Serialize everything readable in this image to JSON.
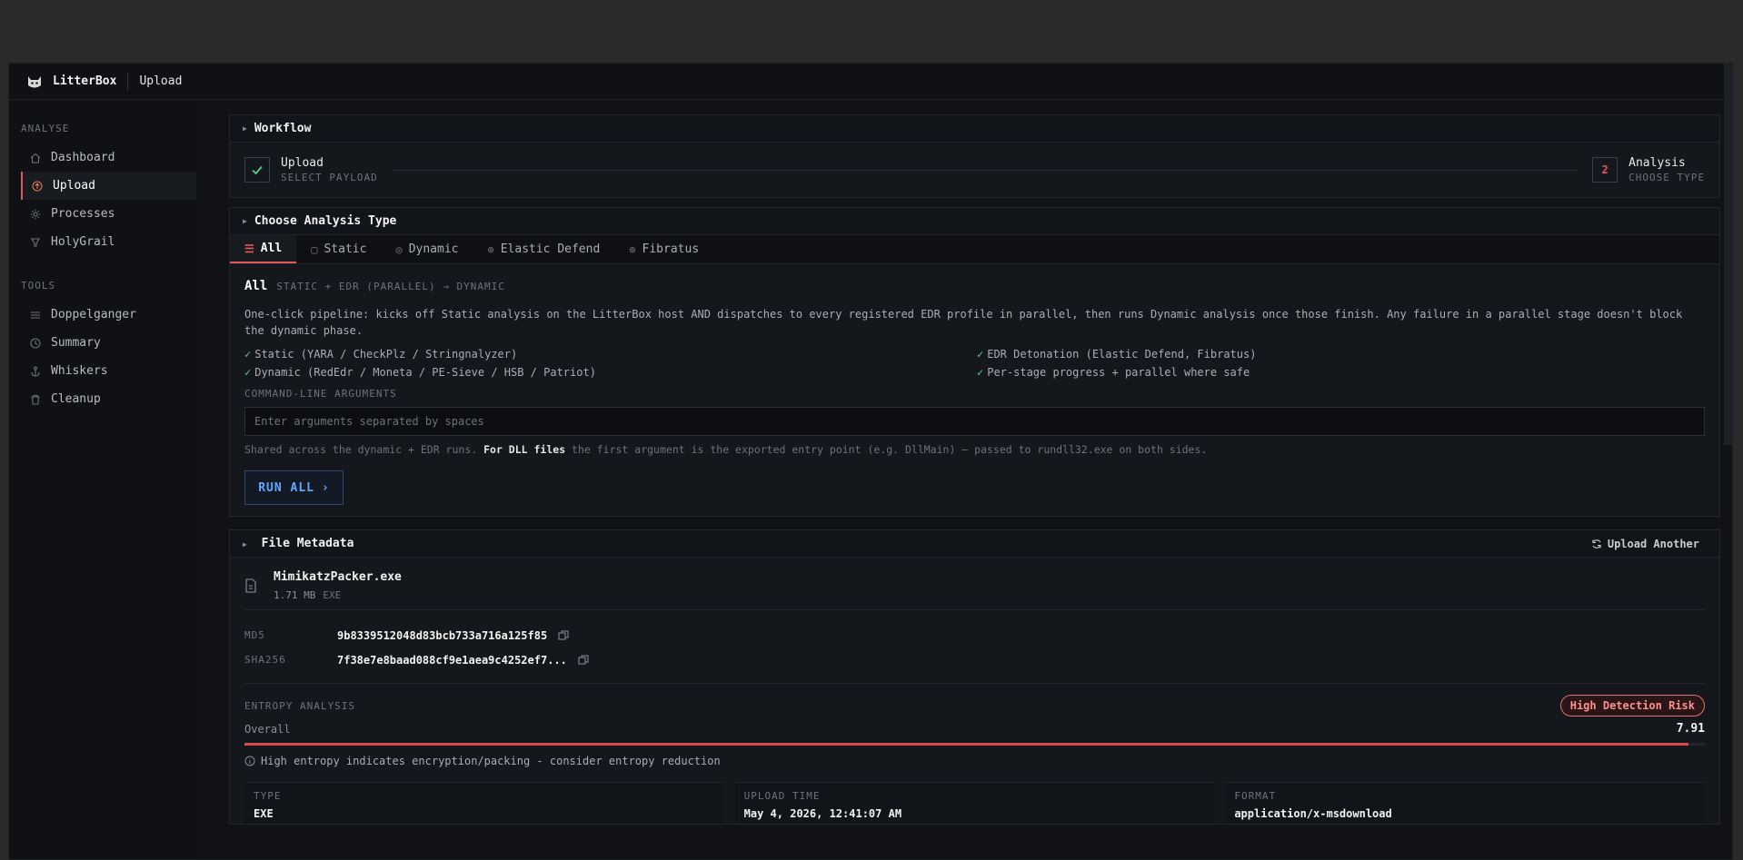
{
  "app": {
    "brand": "LitterBox",
    "page": "Upload"
  },
  "sidebar": {
    "analyse_title": "ANALYSE",
    "analyse_items": [
      {
        "label": "Dashboard",
        "icon": "home-icon"
      },
      {
        "label": "Upload",
        "icon": "upload-icon"
      },
      {
        "label": "Processes",
        "icon": "cog-icon"
      },
      {
        "label": "HolyGrail",
        "icon": "grail-icon"
      }
    ],
    "tools_title": "TOOLS",
    "tools_items": [
      {
        "label": "Doppelganger",
        "icon": "list-icon"
      },
      {
        "label": "Summary",
        "icon": "clock-icon"
      },
      {
        "label": "Whiskers",
        "icon": "anchor-icon"
      },
      {
        "label": "Cleanup",
        "icon": "trash-icon"
      }
    ]
  },
  "workflow": {
    "title": "Workflow",
    "step1": {
      "title": "Upload",
      "sub": "SELECT PAYLOAD"
    },
    "step2": {
      "num": "2",
      "title": "Analysis",
      "sub": "CHOOSE TYPE"
    }
  },
  "analysis": {
    "title": "Choose Analysis Type",
    "tabs": [
      {
        "label": "All",
        "icon": "list-filter-icon"
      },
      {
        "label": "Static",
        "icon": "clipboard-icon"
      },
      {
        "label": "Dynamic",
        "icon": "target-icon"
      },
      {
        "label": "Elastic Defend",
        "icon": "globe-icon"
      },
      {
        "label": "Fibratus",
        "icon": "globe-icon"
      }
    ],
    "heading": "All",
    "pipeline": "STATIC + EDR (PARALLEL) → DYNAMIC",
    "description": "One-click pipeline: kicks off Static analysis on the LitterBox host AND dispatches to every registered EDR profile in parallel, then runs Dynamic analysis once those finish. Any failure in a parallel stage doesn't block the dynamic phase.",
    "checks": [
      "Static (YARA / CheckPlz / Stringnalyzer)",
      "EDR Detonation (Elastic Defend, Fibratus)",
      "Dynamic (RedEdr / Moneta / PE-Sieve / HSB / Patriot)",
      "Per-stage progress + parallel where safe"
    ],
    "check_mark": "✓",
    "args_label": "COMMAND-LINE ARGUMENTS",
    "args_placeholder": "Enter arguments separated by spaces",
    "args_value": "",
    "note_pre": "Shared across the dynamic + EDR runs. ",
    "note_bold": "For DLL files",
    "note_post": " the first argument is the exported entry point (e.g. DllMain) — passed to rundll32.exe on both sides.",
    "run_label": "RUN ALL",
    "run_chevron": "›"
  },
  "metadata": {
    "title": "File Metadata",
    "upload_another": "Upload Another",
    "file_name": "MimikatzPacker.exe",
    "file_size": "1.71 MB",
    "file_ext": "EXE",
    "md5_label": "MD5",
    "md5": "9b8339512048d83bcb733a716a125f85",
    "sha256_label": "SHA256",
    "sha256": "7f38e7e8baad088cf9e1aea9c4252ef7...",
    "entropy_title": "ENTROPY ANALYSIS",
    "risk_badge": "High Detection Risk",
    "overall_label": "Overall",
    "overall_value": "7.91",
    "overall_fraction": 0.989,
    "entropy_note": "High entropy indicates encryption/packing - consider entropy reduction",
    "fields": [
      {
        "key": "TYPE",
        "value": "EXE"
      },
      {
        "key": "UPLOAD TIME",
        "value": "May 4, 2026, 12:41:07 AM"
      },
      {
        "key": "FORMAT",
        "value": "application/x-msdownload"
      }
    ]
  },
  "colors": {
    "accent": "#e05a5a",
    "link": "#5fa8ff",
    "check": "#4fd18b"
  }
}
